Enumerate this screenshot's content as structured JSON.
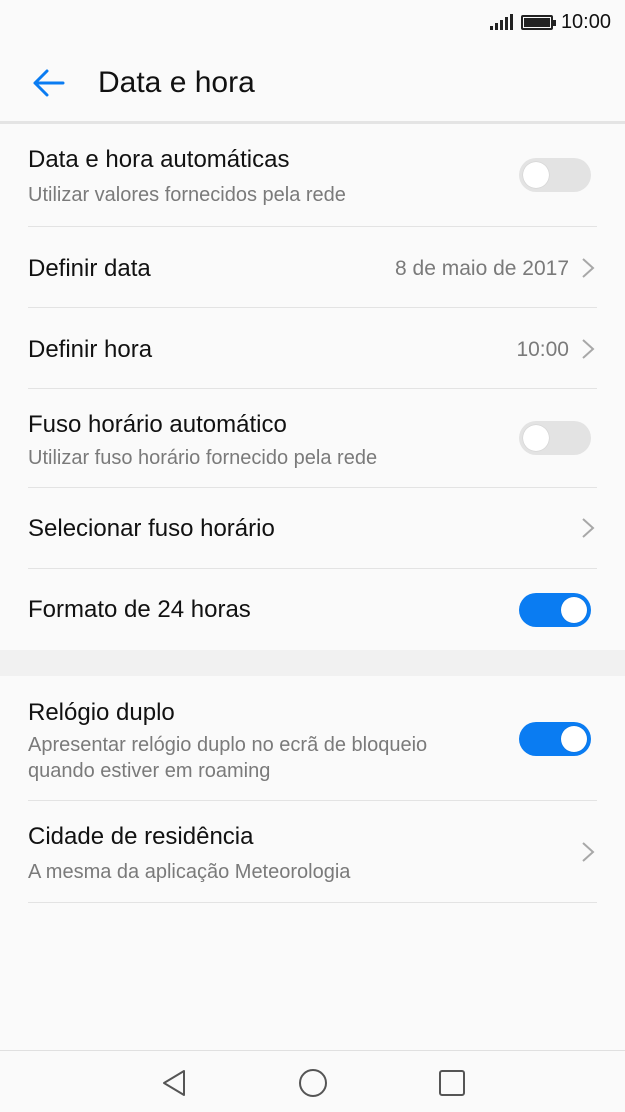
{
  "status_bar": {
    "time": "10:00",
    "battery_level": 1.0
  },
  "app_bar": {
    "title": "Data e hora",
    "back_icon": "arrow-left-icon"
  },
  "colors": {
    "accent": "#0a7cf2",
    "toggle_off": "#e3e3e3",
    "secondary_text": "#7a7a7a"
  },
  "settings": {
    "auto_datetime": {
      "label": "Data e hora automáticas",
      "sub": "Utilizar valores fornecidos pela rede",
      "enabled": false
    },
    "set_date": {
      "label": "Definir data",
      "value": "8 de maio de 2017"
    },
    "set_time": {
      "label": "Definir hora",
      "value": "10:00"
    },
    "auto_timezone": {
      "label": "Fuso horário automático",
      "sub": "Utilizar fuso horário fornecido pela rede",
      "enabled": false
    },
    "select_timezone": {
      "label": "Selecionar fuso horário"
    },
    "format_24h": {
      "label": "Formato de 24 horas",
      "enabled": true
    },
    "dual_clock": {
      "label": "Relógio duplo",
      "sub_line1": "Apresentar relógio duplo no ecrã de bloqueio",
      "sub_line2": "quando estiver em roaming",
      "enabled": true
    },
    "home_city": {
      "label": "Cidade de residência",
      "sub": "A mesma da aplicação Meteorologia"
    }
  },
  "nav_bar": {
    "back": "triangle-back-icon",
    "home": "circle-home-icon",
    "recents": "square-recents-icon"
  }
}
